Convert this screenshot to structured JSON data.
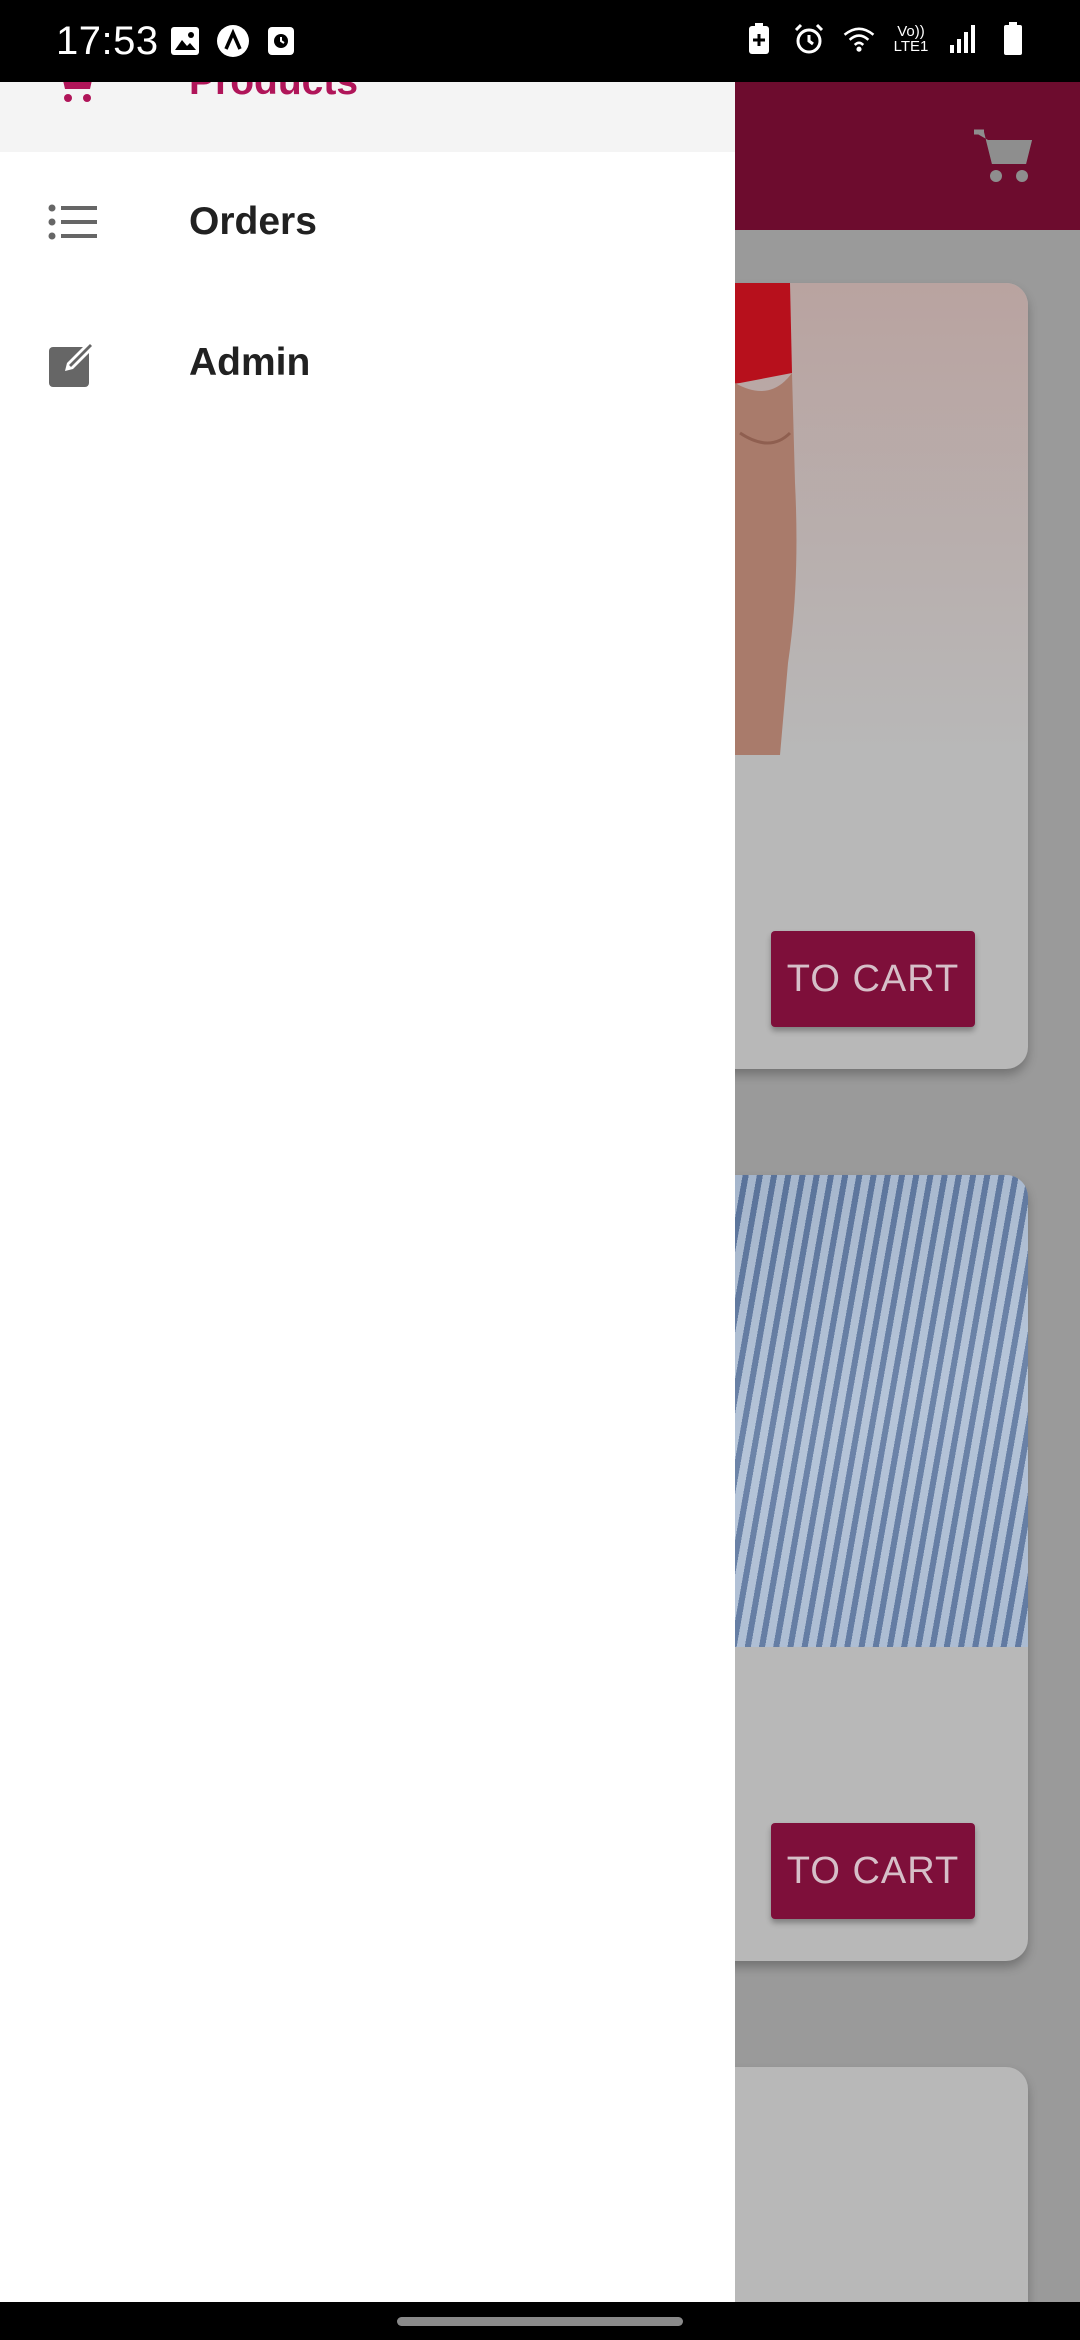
{
  "status_bar": {
    "time": "17:53",
    "left_icons": [
      "image-icon",
      "app-a-icon",
      "clock-app-icon"
    ],
    "right_icons": [
      "battery-saver-icon",
      "alarm-icon",
      "wifi-icon",
      "volte-icon",
      "signal-icon",
      "battery-icon"
    ],
    "volte_line1": "Vo))",
    "volte_line2": "LTE1"
  },
  "drawer": {
    "items": [
      {
        "label": "Products",
        "icon": "cart-icon",
        "selected": true
      },
      {
        "label": "Orders",
        "icon": "list-icon",
        "selected": false
      },
      {
        "label": "Admin",
        "icon": "edit-icon",
        "selected": false
      }
    ]
  },
  "app": {
    "cart_icon": "shopping-cart-icon",
    "products": [
      {
        "button_label": "TO CART"
      },
      {
        "button_label": "TO CART"
      }
    ]
  },
  "colors": {
    "primary": "#b01559",
    "app_bar": "#6d0c2e",
    "button": "#7e0f3a"
  }
}
